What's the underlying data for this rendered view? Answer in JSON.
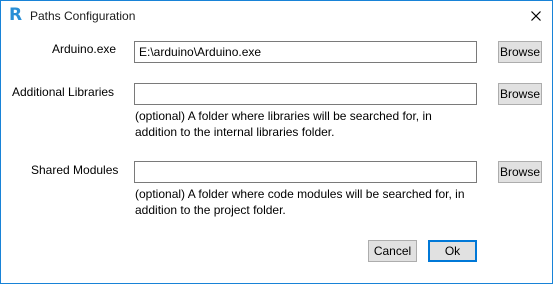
{
  "window": {
    "title": "Paths Configuration",
    "app_icon_glyph": "R"
  },
  "fields": {
    "arduino": {
      "label": "Arduino.exe",
      "value": "E:\\arduino\\Arduino.exe",
      "browse_label": "Browse"
    },
    "libraries": {
      "label": "Additional Libraries",
      "value": "",
      "hint_line1": "(optional) A folder where libraries will be searched for, in",
      "hint_line2": "addition to the internal libraries folder.",
      "browse_label": "Browse"
    },
    "modules": {
      "label": "Shared Modules",
      "value": "",
      "hint_line1": "(optional) A folder where code modules will be searched for, in",
      "hint_line2": "addition to the project folder.",
      "browse_label": "Browse"
    }
  },
  "footer": {
    "cancel_label": "Cancel",
    "ok_label": "Ok"
  },
  "icons": {
    "app": "r-logo-icon",
    "close": "close-icon"
  },
  "colors": {
    "window_border": "#1883d7",
    "app_icon": "#2a8fd6",
    "default_button_border": "#0078d7"
  }
}
